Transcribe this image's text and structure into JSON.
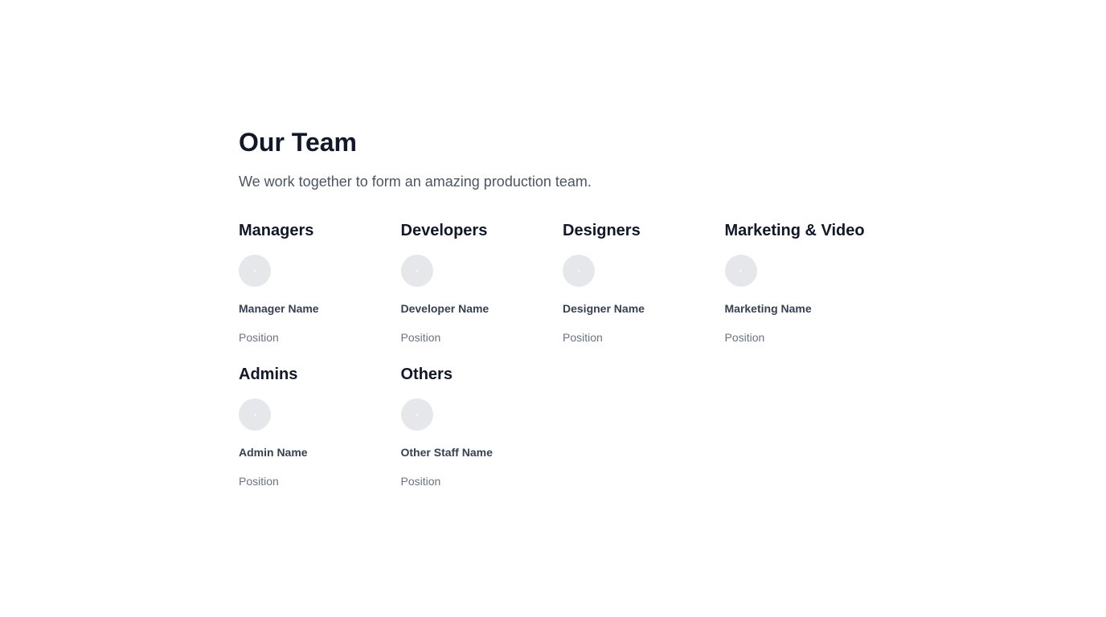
{
  "header": {
    "title": "Our Team",
    "subtitle": "We work together to form an amazing production team."
  },
  "departments": [
    {
      "title": "Managers",
      "member": {
        "name": "Manager Name",
        "position": "Position"
      }
    },
    {
      "title": "Developers",
      "member": {
        "name": "Developer Name",
        "position": "Position"
      }
    },
    {
      "title": "Designers",
      "member": {
        "name": "Designer Name",
        "position": "Position"
      }
    },
    {
      "title": "Marketing & Video",
      "member": {
        "name": "Marketing Name",
        "position": "Position"
      }
    },
    {
      "title": "Admins",
      "member": {
        "name": "Admin Name",
        "position": "Position"
      }
    },
    {
      "title": "Others",
      "member": {
        "name": "Other Staff Name",
        "position": "Position"
      }
    }
  ],
  "colors": {
    "heading": "#111827",
    "subtitle": "#4b5563",
    "name": "#374151",
    "position": "#6b7280",
    "avatar_placeholder": "#e5e7eb"
  },
  "icons": {
    "avatar": "avatar-placeholder-icon"
  }
}
